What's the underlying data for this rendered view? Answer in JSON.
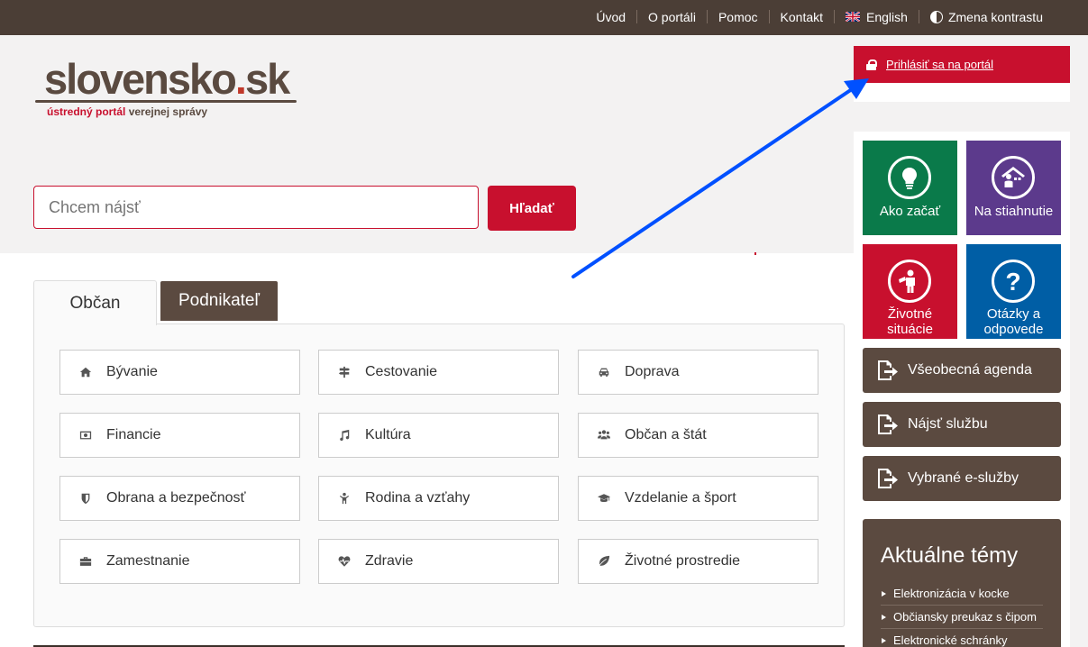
{
  "topnav": {
    "items": [
      {
        "label": "Úvod"
      },
      {
        "label": "O portáli"
      },
      {
        "label": "Pomoc"
      },
      {
        "label": "Kontakt"
      },
      {
        "label": "English"
      },
      {
        "label": "Zmena kontrastu"
      }
    ]
  },
  "logo": {
    "main": "slovensko",
    "dot": ".",
    "tld": "sk",
    "sub_red": "ústredný portál",
    "sub_brown": "verejnej správy"
  },
  "login": {
    "label": "Prihlásiť sa na portál"
  },
  "search": {
    "placeholder": "Chcem nájsť",
    "button": "Hľadať"
  },
  "tabs": {
    "active": "Občan",
    "inactive": "Podnikateľ"
  },
  "categories": [
    {
      "label": "Bývanie",
      "icon": "home-icon"
    },
    {
      "label": "Cestovanie",
      "icon": "signpost-icon"
    },
    {
      "label": "Doprava",
      "icon": "car-icon"
    },
    {
      "label": "Financie",
      "icon": "money-icon"
    },
    {
      "label": "Kultúra",
      "icon": "music-icon"
    },
    {
      "label": "Občan a štát",
      "icon": "users-icon"
    },
    {
      "label": "Obrana a bezpečnosť",
      "icon": "shield-icon"
    },
    {
      "label": "Rodina a vzťahy",
      "icon": "child-icon"
    },
    {
      "label": "Vzdelanie a šport",
      "icon": "graduation-cap-icon"
    },
    {
      "label": "Zamestnanie",
      "icon": "briefcase-icon"
    },
    {
      "label": "Zdravie",
      "icon": "heartbeat-icon"
    },
    {
      "label": "Životné prostredie",
      "icon": "leaf-icon"
    }
  ],
  "tiles": [
    {
      "label": "Ako začať",
      "color": "#0a7a4a",
      "icon": "lightbulb-icon"
    },
    {
      "label": "Na stiahnutie",
      "color": "#5c3a8c",
      "icon": "house-person-icon"
    },
    {
      "label": "Životné situácie",
      "line1": "Životné",
      "line2": "situácie",
      "color": "#c8102e",
      "icon": "person-icon"
    },
    {
      "label": "Otázky a odpovede",
      "line1": "Otázky a",
      "line2": "odpovede",
      "color": "#005ea5",
      "icon": "question-icon"
    }
  ],
  "agenda": [
    {
      "label": "Všeobecná agenda"
    },
    {
      "label": "Nájsť službu"
    },
    {
      "label": "Vybrané e-služby"
    }
  ],
  "topics": {
    "title": "Aktuálne témy",
    "items": [
      {
        "label": "Elektronizácia v kocke"
      },
      {
        "label": "Občiansky preukaz s čipom"
      },
      {
        "label": "Elektronické schránky"
      }
    ]
  },
  "colors": {
    "topbar": "#4b3e36",
    "brand_red": "#c8102e",
    "brown": "#5b4a40",
    "annotation_arrow": "#0050ff"
  }
}
